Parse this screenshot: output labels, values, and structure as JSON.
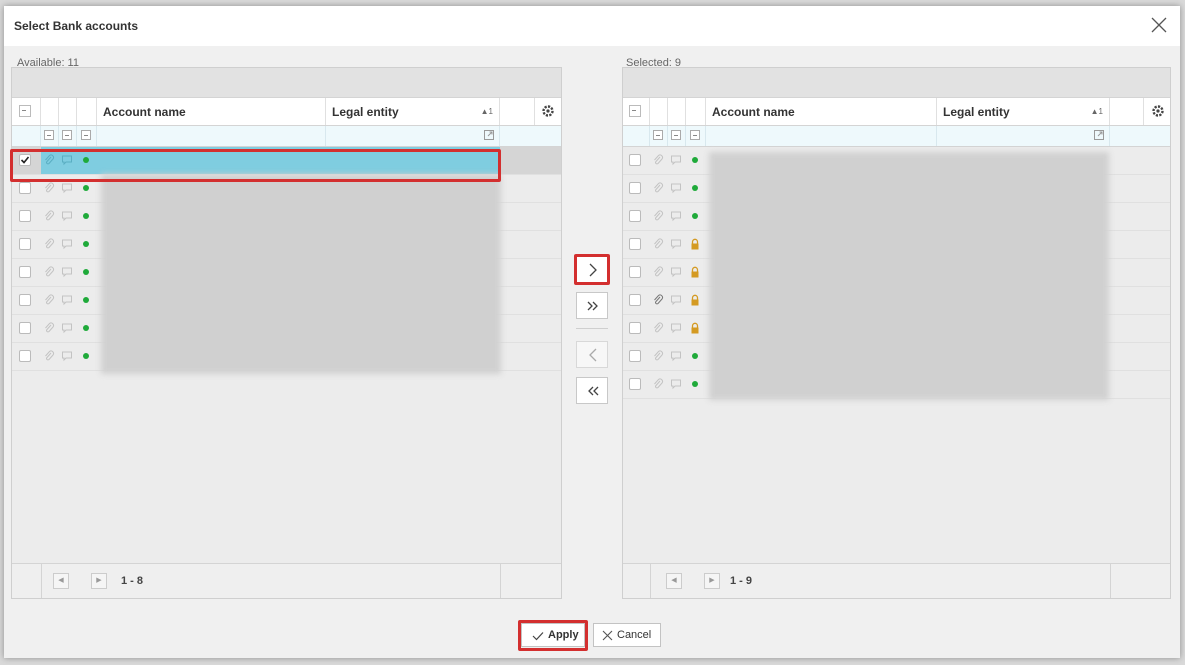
{
  "dialog": {
    "title": "Select Bank accounts"
  },
  "available": {
    "count_label": "Available: 11",
    "columns": {
      "account_name": "Account name",
      "legal_entity": "Legal entity",
      "sort_indicator": "▲1"
    },
    "pager_range": "1 - 8",
    "rows": [
      {
        "checked": true,
        "status": "active"
      },
      {
        "checked": false,
        "status": "active"
      },
      {
        "checked": false,
        "status": "active"
      },
      {
        "checked": false,
        "status": "active"
      },
      {
        "checked": false,
        "status": "active"
      },
      {
        "checked": false,
        "status": "active"
      },
      {
        "checked": false,
        "status": "active"
      },
      {
        "checked": false,
        "status": "active"
      }
    ]
  },
  "selected": {
    "count_label": "Selected: 9",
    "columns": {
      "account_name": "Account name",
      "legal_entity": "Legal entity",
      "sort_indicator": "▲1"
    },
    "pager_range": "1 - 9",
    "rows": [
      {
        "status": "active",
        "attachment": false
      },
      {
        "status": "active",
        "attachment": false
      },
      {
        "status": "active",
        "attachment": false
      },
      {
        "status": "locked",
        "attachment": false
      },
      {
        "status": "locked",
        "attachment": false
      },
      {
        "status": "locked",
        "attachment": true
      },
      {
        "status": "locked",
        "attachment": false
      },
      {
        "status": "active",
        "attachment": false
      },
      {
        "status": "active",
        "attachment": false
      }
    ]
  },
  "footer": {
    "apply_label": "Apply",
    "cancel_label": "Cancel"
  },
  "colors": {
    "selection": "#7fcde0",
    "highlight": "#d32f2f",
    "active_dot": "#1faa3a",
    "lock": "#d49a22"
  },
  "icons": [
    "close-icon",
    "settings-gear-icon",
    "attachment-icon",
    "comment-icon",
    "status-dot-icon",
    "lock-icon",
    "move-right-icon",
    "move-all-right-icon",
    "move-left-icon",
    "move-all-left-icon",
    "check-icon",
    "cancel-x-icon",
    "pager-prev-icon",
    "pager-next-icon",
    "expand-icon"
  ]
}
